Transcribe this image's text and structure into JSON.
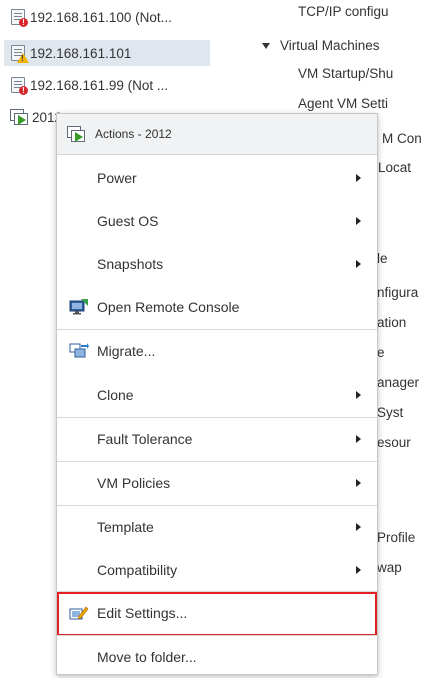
{
  "left_tree": {
    "items": [
      {
        "label": "192.168.161.100 (Not...",
        "status": "error"
      },
      {
        "label": "192.168.161.101",
        "status": "warning",
        "selected": true
      },
      {
        "label": "192.168.161.99 (Not ...",
        "status": "error"
      },
      {
        "label": "2012",
        "status": "vm-on"
      }
    ]
  },
  "right_tree": {
    "items": [
      {
        "label": "TCP/IP configu"
      },
      {
        "label": "Virtual Machines",
        "expanded": true
      },
      {
        "label": "VM Startup/Shu"
      },
      {
        "label": "Agent VM Setti"
      },
      {
        "label": "M Con"
      },
      {
        "label": "Locat"
      },
      {
        "label": "le"
      },
      {
        "label": "nfigura"
      },
      {
        "label": "ation"
      },
      {
        "label": "e"
      },
      {
        "label": "anager"
      },
      {
        "label": "Syst"
      },
      {
        "label": "esour"
      },
      {
        "label": "Profile"
      },
      {
        "label": "wap"
      }
    ]
  },
  "menu": {
    "title": "Actions - 2012",
    "items": [
      {
        "label": "Power",
        "submenu": true
      },
      {
        "label": "Guest OS",
        "submenu": true
      },
      {
        "label": "Snapshots",
        "submenu": true
      },
      {
        "label": "Open Remote Console",
        "icon": "remote-console-icon"
      },
      {
        "label": "Migrate...",
        "icon": "migrate-icon"
      },
      {
        "label": "Clone",
        "submenu": true
      },
      {
        "label": "Fault Tolerance",
        "submenu": true
      },
      {
        "label": "VM Policies",
        "submenu": true
      },
      {
        "label": "Template",
        "submenu": true
      },
      {
        "label": "Compatibility",
        "submenu": true
      },
      {
        "label": "Edit Settings...",
        "icon": "edit-settings-icon",
        "highlighted": true
      },
      {
        "label": "Move to folder..."
      }
    ]
  },
  "colors": {
    "highlight_border": "#e32026",
    "selected_row": "#dfe6ee",
    "menu_header": "#f0f2f4"
  }
}
